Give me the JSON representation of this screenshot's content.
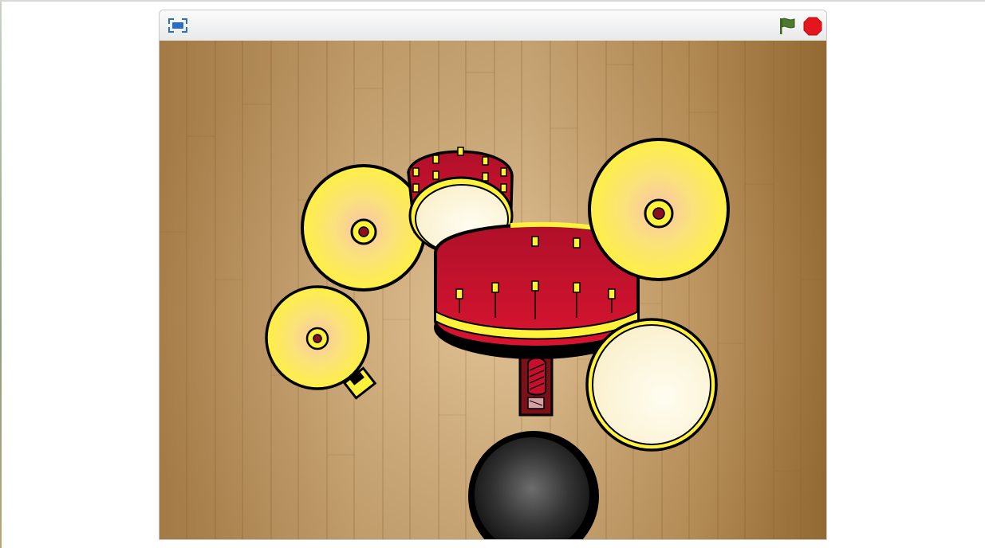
{
  "player": {
    "controls": {
      "fullscreen_icon": "fullscreen-icon",
      "green_flag_icon": "green-flag-icon",
      "stop_icon": "stop-sign-icon"
    },
    "colors": {
      "flag": "#4d7a2c",
      "stop": "#e4151c",
      "fullscreen": "#2a6fbf"
    }
  },
  "stage": {
    "background": "wood-floor",
    "colors": {
      "wood_light": "#dcb57e",
      "wood_mid": "#c89a5c",
      "wood_dark": "#a8783a",
      "cymbal": "#ffee3a",
      "cymbal_center": "#f7caa7",
      "drum_shell": "#c8102e",
      "drum_head": "#fffbe2",
      "bass_pad": "#d4a0a0",
      "stool": "#3a3a3a",
      "outline": "#000000"
    },
    "sprites": [
      "crash-cymbal-left",
      "hihat-cymbal",
      "hihat-pedal",
      "ride-cymbal-right",
      "tom-drum",
      "bass-drum",
      "bass-drum-pedal",
      "snare-drum",
      "drum-stool"
    ]
  }
}
